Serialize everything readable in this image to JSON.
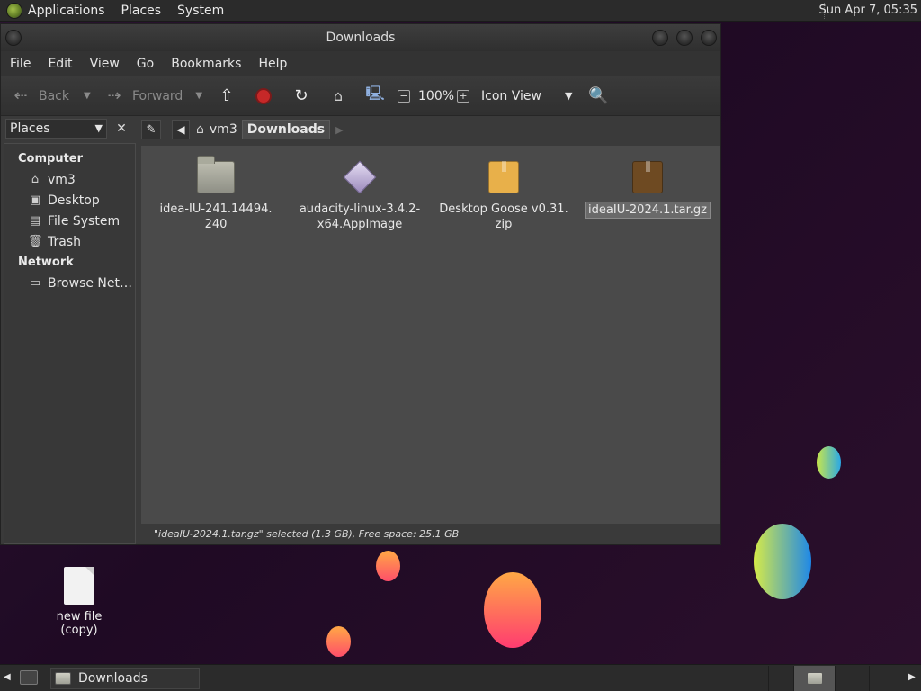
{
  "top_panel": {
    "menus": [
      "Applications",
      "Places",
      "System"
    ],
    "clock": "Sun Apr  7, 05:35"
  },
  "window": {
    "title": "Downloads",
    "menu": [
      "File",
      "Edit",
      "View",
      "Go",
      "Bookmarks",
      "Help"
    ],
    "toolbar": {
      "back": "Back",
      "forward": "Forward",
      "zoom": "100%",
      "view_mode": "Icon View"
    },
    "sidebar": {
      "selector": "Places",
      "sections": [
        {
          "heading": "Computer",
          "items": [
            {
              "label": "vm3",
              "icon": "home-icon"
            },
            {
              "label": "Desktop",
              "icon": "desktop-icon"
            },
            {
              "label": "File System",
              "icon": "drive-icon"
            },
            {
              "label": "Trash",
              "icon": "trash-icon"
            }
          ]
        },
        {
          "heading": "Network",
          "items": [
            {
              "label": "Browse Net…",
              "icon": "network-icon"
            }
          ]
        }
      ]
    },
    "path": [
      "vm3",
      "Downloads"
    ],
    "files": [
      {
        "name": "idea-IU-241.14494.240",
        "line1": "idea-IU-241.14494.",
        "line2": "240",
        "type": "folder"
      },
      {
        "name": "audacity-linux-3.4.2-x64.AppImage",
        "line1": "audacity-linux-3.4.2-",
        "line2": "x64.AppImage",
        "type": "appimage"
      },
      {
        "name": "Desktop Goose v0.31.zip",
        "line1": "Desktop Goose v0.31.",
        "line2": "zip",
        "type": "archive",
        "color": "#e8b04a"
      },
      {
        "name": "ideaIU-2024.1.tar.gz",
        "line1": "ideaIU-2024.1.tar.gz",
        "line2": "",
        "type": "archive",
        "color": "#6e4a22",
        "selected": true
      }
    ],
    "status": "\"ideaIU-2024.1.tar.gz\" selected (1.3 GB), Free space: 25.1 GB"
  },
  "desktop": {
    "icons": [
      {
        "label": "new file (copy)",
        "icon": "text-file-icon"
      }
    ]
  },
  "bottom_panel": {
    "task": "Downloads"
  }
}
